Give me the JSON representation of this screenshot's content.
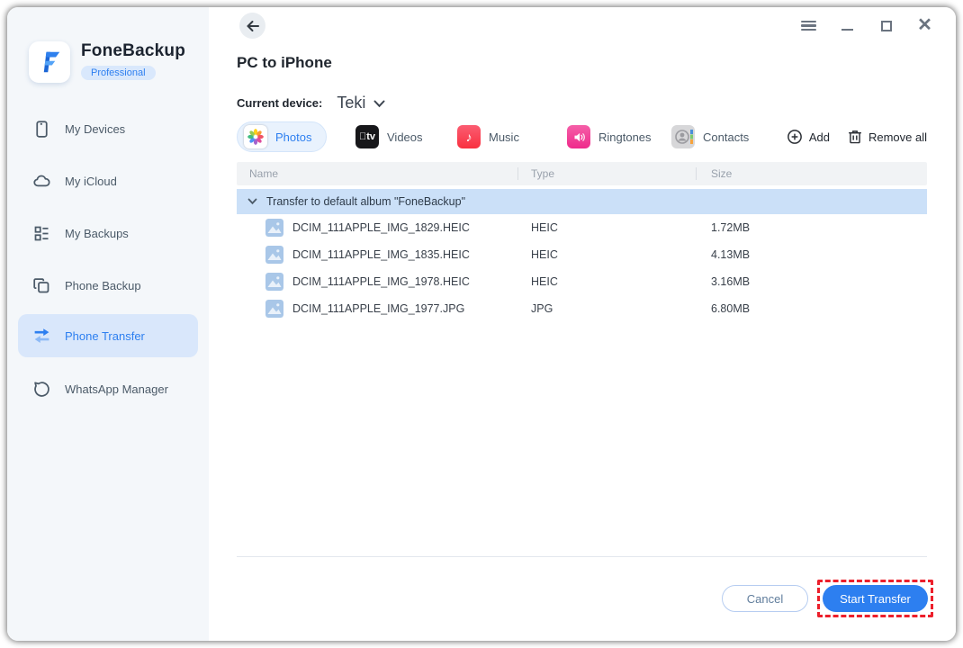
{
  "brand": {
    "name": "FoneBackup",
    "badge": "Professional"
  },
  "header": {
    "title": "PC to iPhone",
    "device_label": "Current device:",
    "device_name": "Teki"
  },
  "sidebar": {
    "items": [
      {
        "label": "My Devices",
        "icon": "phone-icon"
      },
      {
        "label": "My iCloud",
        "icon": "cloud-icon"
      },
      {
        "label": "My Backups",
        "icon": "backup-list-icon"
      },
      {
        "label": "Phone Backup",
        "icon": "copy-icon"
      },
      {
        "label": "Phone Transfer",
        "icon": "transfer-arrows-icon",
        "selected": true
      },
      {
        "label": "WhatsApp Manager",
        "icon": "chat-bubble-icon"
      }
    ]
  },
  "tabs": [
    {
      "label": "Photos",
      "icon": "photos-flower-icon",
      "active": true
    },
    {
      "label": "Videos",
      "icon": "apple-tv-icon"
    },
    {
      "label": "Music",
      "icon": "music-note-icon"
    },
    {
      "label": "Ringtones",
      "icon": "speaker-icon"
    },
    {
      "label": "Contacts",
      "icon": "contacts-book-icon"
    }
  ],
  "toolbar": {
    "add_label": "Add",
    "remove_all_label": "Remove all"
  },
  "table": {
    "columns": [
      {
        "label": "Name"
      },
      {
        "label": "Type"
      },
      {
        "label": "Size"
      }
    ],
    "group_label": "Transfer to default album \"FoneBackup\"",
    "rows": [
      {
        "name": "DCIM_111APPLE_IMG_1829.HEIC",
        "type": "HEIC",
        "size": "1.72MB"
      },
      {
        "name": "DCIM_111APPLE_IMG_1835.HEIC",
        "type": "HEIC",
        "size": "4.13MB"
      },
      {
        "name": "DCIM_111APPLE_IMG_1978.HEIC",
        "type": "HEIC",
        "size": "3.16MB"
      },
      {
        "name": "DCIM_111APPLE_IMG_1977.JPG",
        "type": "JPG",
        "size": "6.80MB"
      }
    ]
  },
  "footer": {
    "cancel_label": "Cancel",
    "start_label": "Start Transfer"
  },
  "colors": {
    "accent": "#2d7ff0",
    "group_row": "#cbe0f8",
    "sidebar_selected": "#d9e7fb",
    "annotation_red": "#ec1f2b",
    "music_red": "#f9303f",
    "ringtone_pink": "#ef2a8b"
  }
}
